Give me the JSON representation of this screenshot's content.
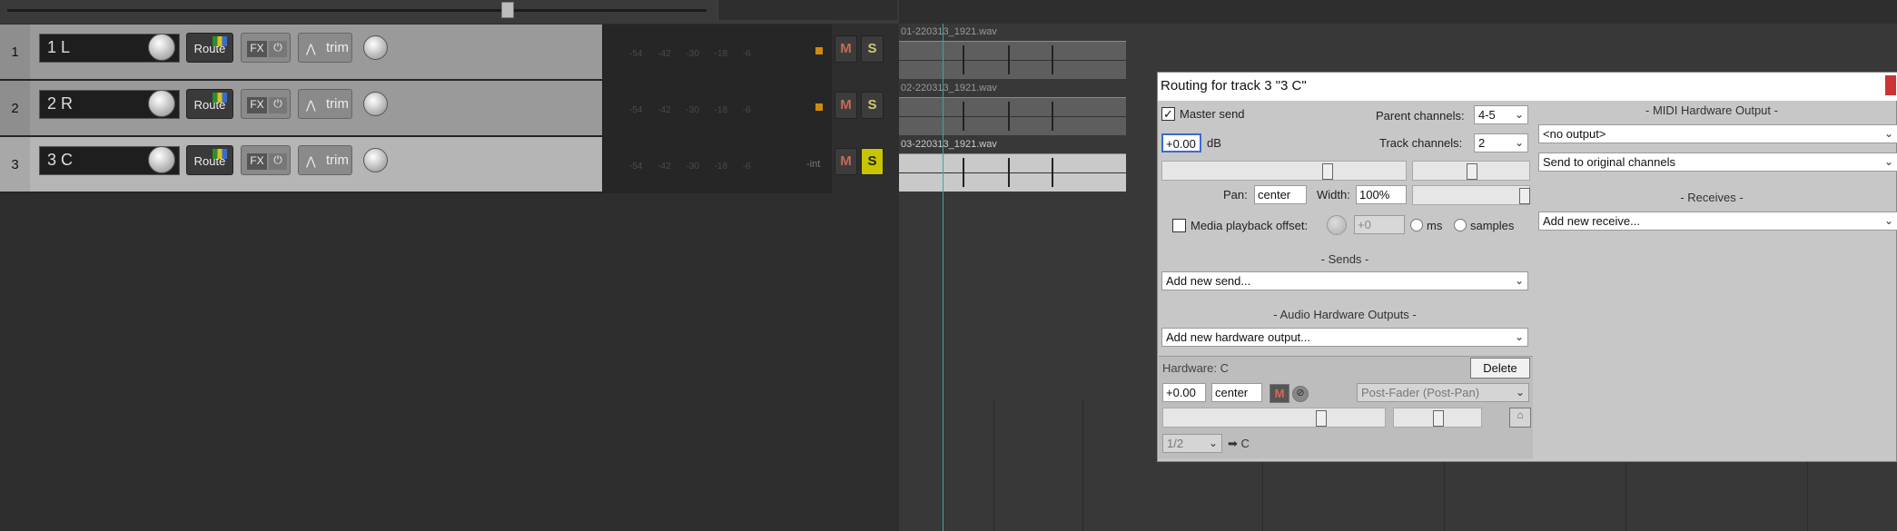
{
  "tracks": [
    {
      "num": "1",
      "name": "1 L",
      "route_label": "Route",
      "fx_label": "FX",
      "trim_label": "trim",
      "mute_label": "M",
      "solo_label": "S",
      "solo_on": false,
      "selected": false
    },
    {
      "num": "2",
      "name": "2 R",
      "route_label": "Route",
      "fx_label": "FX",
      "trim_label": "trim",
      "mute_label": "M",
      "solo_label": "S",
      "solo_on": false,
      "selected": false
    },
    {
      "num": "3",
      "name": "3 C",
      "route_label": "Route",
      "fx_label": "FX",
      "trim_label": "trim",
      "mute_label": "M",
      "solo_label": "S",
      "solo_on": true,
      "selected": true
    }
  ],
  "meter_ticks": "-54 -42 -30 -18 -6",
  "meter_int_label": "-int",
  "items": [
    "01-220313_1921.wav",
    "02-220313_1921.wav",
    "03-220313_1921.wav"
  ],
  "routing": {
    "title": "Routing for track 3 \"3 C\"",
    "master_send_label": "Master send",
    "master_send_checked": true,
    "parent_channels_label": "Parent channels:",
    "parent_channels_value": "4-5",
    "volume_value": "+0.00",
    "db_label": "dB",
    "track_channels_label": "Track channels:",
    "track_channels_value": "2",
    "pan_label": "Pan:",
    "pan_value": "center",
    "width_label": "Width:",
    "width_value": "100%",
    "media_offset_label": "Media playback offset:",
    "media_offset_value": "+0",
    "ms_label": "ms",
    "samples_label": "samples",
    "sends_header": "- Sends -",
    "add_send_label": "Add new send...",
    "audio_hw_header": "- Audio Hardware Outputs -",
    "add_hw_label": "Add new hardware output...",
    "hw_label": "Hardware: C",
    "delete_label": "Delete",
    "hw_volume": "+0.00",
    "hw_pan": "center",
    "hw_mute_label": "M",
    "hw_mode": "Post-Fader (Post-Pan)",
    "hw_channel": "1/2",
    "hw_dest": "➡ C",
    "midi_hw_header": "- MIDI Hardware Output -",
    "midi_output_value": "<no output>",
    "midi_channels_value": "Send to original channels",
    "receives_header": "- Receives -",
    "add_receive_label": "Add new receive..."
  }
}
